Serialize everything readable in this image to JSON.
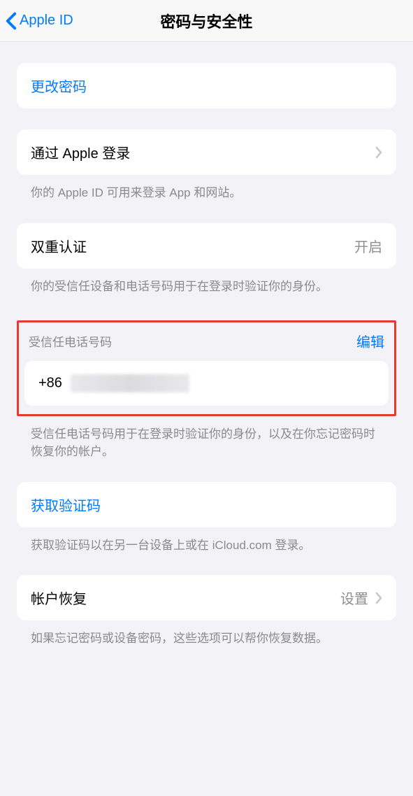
{
  "nav": {
    "back_label": "Apple ID",
    "title": "密码与安全性"
  },
  "change_password": {
    "label": "更改密码"
  },
  "sign_in_with_apple": {
    "label": "通过 Apple 登录",
    "caption": "你的 Apple ID 可用来登录 App 和网站。"
  },
  "two_factor": {
    "label": "双重认证",
    "value": "开启",
    "caption": "你的受信任设备和电话号码用于在登录时验证你的身份。"
  },
  "trusted_numbers": {
    "header": "受信任电话号码",
    "edit": "编辑",
    "prefix": "+86",
    "caption": "受信任电话号码用于在登录时验证你的身份，以及在你忘记密码时恢复你的帐户。"
  },
  "get_code": {
    "label": "获取验证码",
    "caption": "获取验证码以在另一台设备上或在 iCloud.com 登录。"
  },
  "account_recovery": {
    "label": "帐户恢复",
    "value": "设置",
    "caption": "如果忘记密码或设备密码，这些选项可以帮你恢复数据。"
  }
}
